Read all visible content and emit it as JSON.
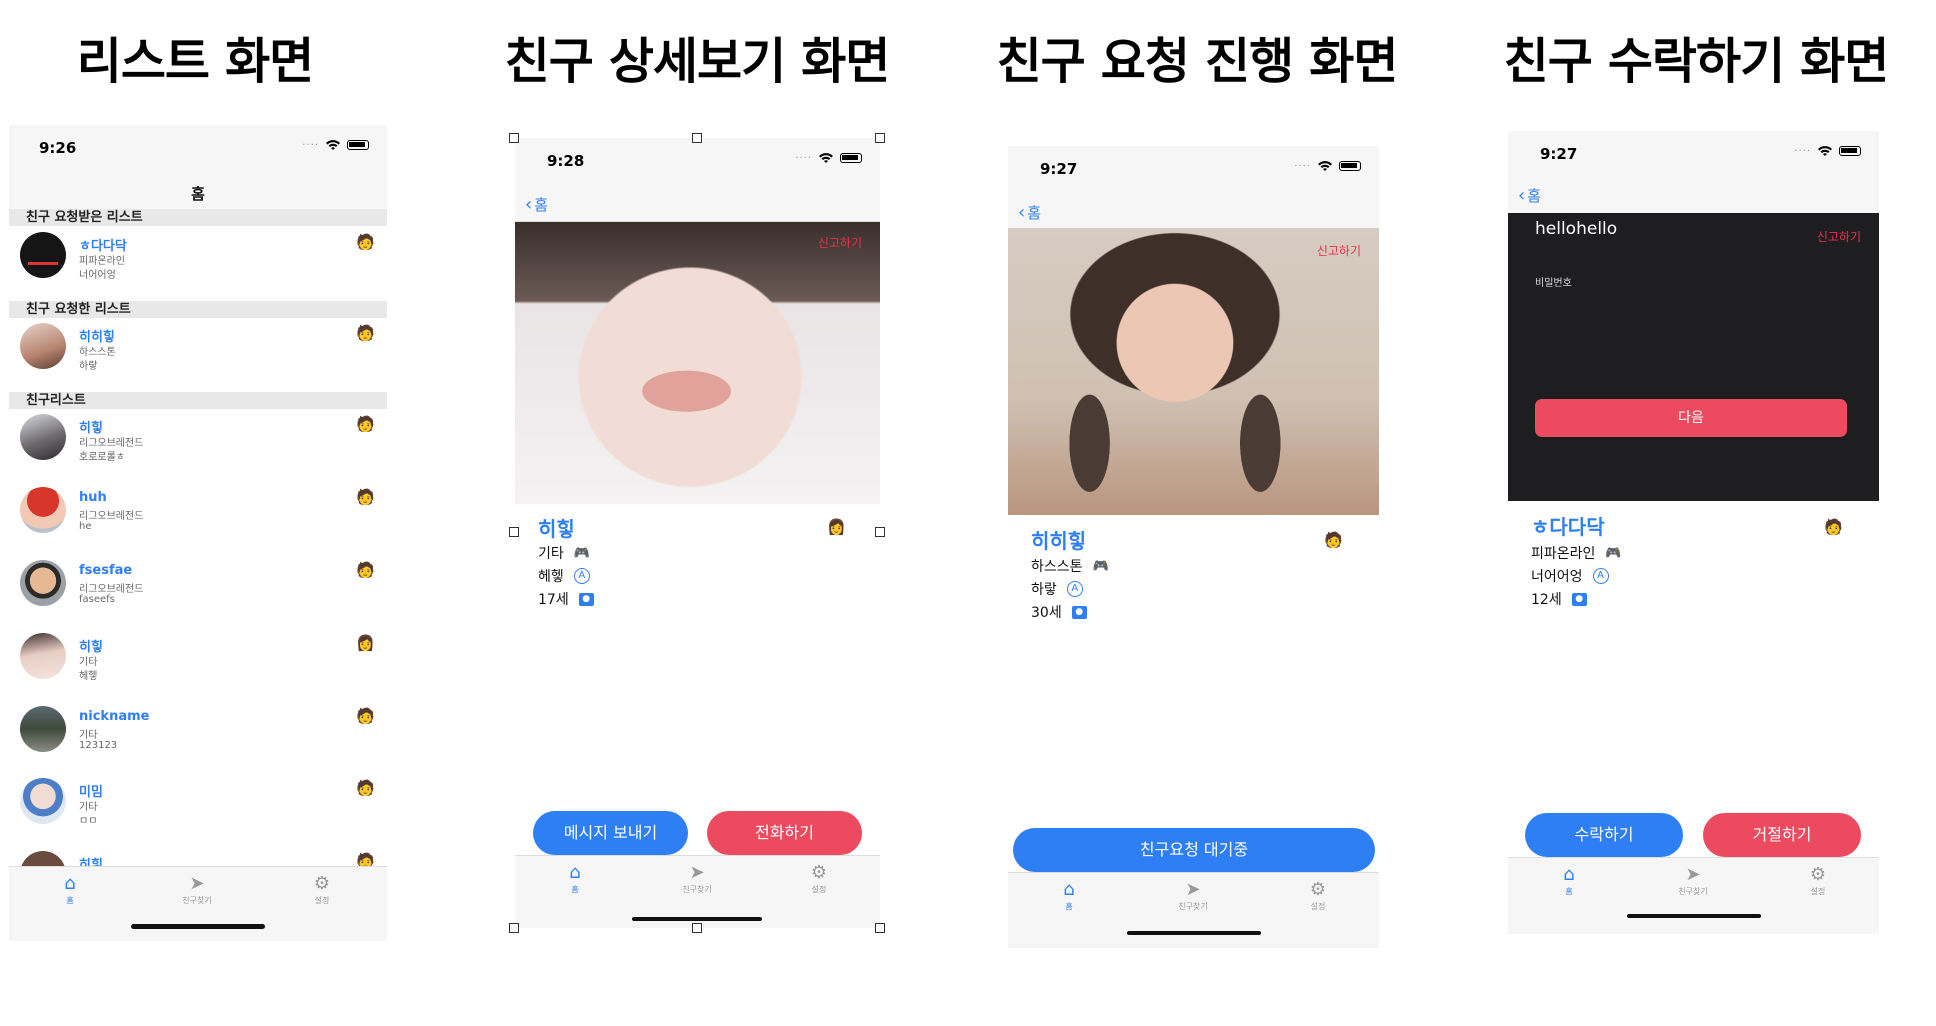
{
  "titles": [
    "리스트 화면",
    "친구 상세보기 화면",
    "친구 요청 진행 화면",
    "친구 수락하기 화면"
  ],
  "screen1": {
    "time": "9:26",
    "nav_title": "홈",
    "sections": [
      "친구 요청받은 리스트",
      "친구 요청한 리스트",
      "친구리스트"
    ],
    "rows": [
      {
        "name": "ㅎ다다닥",
        "sub1": "피파온라인",
        "sub2": "너어어엉"
      },
      {
        "name": "히히힣",
        "sub1": "하스스톤",
        "sub2": "하랗"
      },
      {
        "name": "히힣",
        "sub1": "리그오브레전드",
        "sub2": "호로로롤ㅎ"
      },
      {
        "name": "huh",
        "sub1": "리그오브레전드",
        "sub2": "he"
      },
      {
        "name": "fsesfae",
        "sub1": "리그오브레전드",
        "sub2": "faseefs"
      },
      {
        "name": "히힣",
        "sub1": "기타",
        "sub2": "헤헿"
      },
      {
        "name": "nickname",
        "sub1": "기타",
        "sub2": "123123"
      },
      {
        "name": "미밈",
        "sub1": "기타",
        "sub2": "ㅁㅁ"
      },
      {
        "name": "히힣",
        "sub1": "",
        "sub2": ""
      }
    ],
    "tabs": [
      "홈",
      "친구찾기",
      "설정"
    ]
  },
  "screen2": {
    "time": "9:28",
    "back_label": "홈",
    "report": "신고하기",
    "name": "히힣",
    "game": "기타",
    "desc": "헤헿",
    "age": "17세",
    "btn_message": "메시지 보내기",
    "btn_call": "전화하기",
    "tabs": [
      "홈",
      "친구찾기",
      "설정"
    ]
  },
  "screen3": {
    "time": "9:27",
    "back_label": "홈",
    "report": "신고하기",
    "name": "히히힣",
    "game": "하스스톤",
    "desc": "하랗",
    "age": "30세",
    "btn_wait": "친구요청 대기중",
    "tabs": [
      "홈",
      "친구찾기",
      "설정"
    ]
  },
  "screen4": {
    "time": "9:27",
    "back_label": "홈",
    "report": "신고하기",
    "dark_title": "hellohello",
    "password_label": "비밀번호",
    "next_label": "다음",
    "name": "ㅎ다다닥",
    "game": "피파온라인",
    "desc": "너어어엉",
    "age": "12세",
    "btn_accept": "수락하기",
    "btn_reject": "거절하기",
    "tabs": [
      "홈",
      "친구찾기",
      "설정"
    ]
  },
  "colors": {
    "accent": "#2f7ff4",
    "danger": "#eb4a5f",
    "dark_bg": "#1e1e20"
  }
}
